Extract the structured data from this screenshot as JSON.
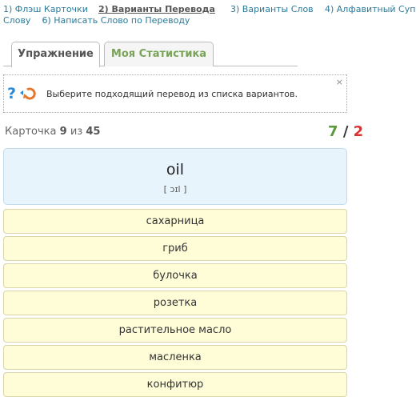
{
  "nav": {
    "items": [
      "1) Флэш Карточки",
      "2) Варианты Перевода",
      "3) Варианты Слов",
      "4) Алфавитный Суп",
      "Слову",
      "6) Написать Слово по Переводу"
    ]
  },
  "tabs": {
    "exercise": "Упражнение",
    "stats": "Моя Статистика"
  },
  "hint": {
    "text": "Выберите подходящий перевод из списка вариантов.",
    "close": "×"
  },
  "counter": {
    "label": "Карточка",
    "current": "9",
    "of": "из",
    "total": "45"
  },
  "score": {
    "correct": "7",
    "sep": "/",
    "wrong": "2"
  },
  "card": {
    "word": "oil",
    "transcription": "[ ɔɪl ]"
  },
  "options": [
    "сахарница",
    "гриб",
    "булочка",
    "розетка",
    "растительное масло",
    "масленка",
    "конфитюр"
  ]
}
